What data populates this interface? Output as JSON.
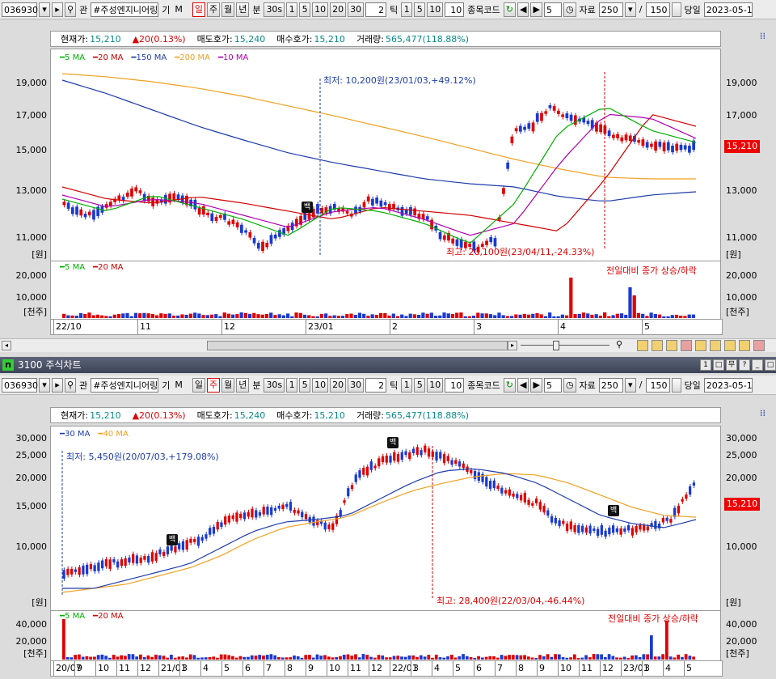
{
  "toolbar": {
    "code": "036930",
    "name": "#주성엔지니어링",
    "flags": [
      "관",
      "기",
      "M"
    ],
    "periods": [
      "일",
      "주",
      "월",
      "년"
    ],
    "unit_label": "분",
    "minute_values": [
      "30s",
      "1",
      "5",
      "10",
      "20",
      "30"
    ],
    "tick_value": "2",
    "tick_label": "틱",
    "tick_values": [
      "1",
      "5",
      "10"
    ],
    "tick_input": "10",
    "code_label": "종목코드",
    "step_value": "5",
    "data_label": "자료",
    "data_count": "250",
    "page_sep": "/",
    "page_value": "150",
    "today_label": "당일",
    "date": "2023-05-1"
  },
  "info": {
    "cur_label": "현재가:",
    "cur_value": "15,210",
    "change_value": "▲20(0.13%)",
    "ask_label": "매도호가:",
    "ask_value": "15,240",
    "bid_label": "매수호가:",
    "bid_value": "15,210",
    "volume_label": "거래량:",
    "volume_value": "565,477(118.88%)"
  },
  "chart1": {
    "ma_legend": [
      {
        "name": "5 MA",
        "color": "#00b000"
      },
      {
        "name": "20 MA",
        "color": "#d00000"
      },
      {
        "name": "150 MA",
        "color": "#1e3caa"
      },
      {
        "name": "200 MA",
        "color": "#f0a020"
      },
      {
        "name": "10 MA",
        "color": "#b000b0"
      }
    ],
    "y_ticks": [
      "19,000",
      "17,000",
      "15,000",
      "13,000",
      "11,000"
    ],
    "unit": "[원]",
    "low_annot": "최저: 10,200원(23/01/03,+49.12%)",
    "high_annot": "최고: 20,100원(23/04/11,-24.33%)",
    "vol_legend": [
      {
        "name": "5 MA",
        "color": "#00b000"
      },
      {
        "name": "20 MA",
        "color": "#d00000"
      }
    ],
    "vol_ticks": [
      "20,000",
      "10,000"
    ],
    "vol_unit": "[천주]",
    "vol_annot": "전일대비 종가 상승/하락",
    "x_labels": [
      "22/10",
      "11",
      "12",
      "23/01",
      "2",
      "3",
      "4",
      "5"
    ],
    "price_tag": "15,210"
  },
  "window2": {
    "title": "3100 주식차트",
    "logo": "n",
    "buttons": [
      "1",
      "□",
      "무",
      "?",
      "_",
      "□",
      "×"
    ]
  },
  "chart2": {
    "ma_legend": [
      {
        "name": "30 MA",
        "color": "#1e3caa"
      },
      {
        "name": "40 MA",
        "color": "#f0a020"
      }
    ],
    "y_ticks": [
      "30,000",
      "25,000",
      "20,000",
      "15,000",
      "10,000"
    ],
    "unit": "[원]",
    "low_annot": "최저: 5,450원(20/07/03,+179.08%)",
    "high_annot": "최고: 28,400원(22/03/04,-46.44%)",
    "vol_legend": [
      {
        "name": "5 MA",
        "color": "#00b000"
      },
      {
        "name": "20 MA",
        "color": "#d00000"
      }
    ],
    "vol_ticks": [
      "40,000",
      "20,000"
    ],
    "vol_unit": "[천주]",
    "vol_annot": "전일대비 종가 상승/하락",
    "x_labels": [
      "20/07",
      "9",
      "10",
      "11",
      "12",
      "21/01",
      "3",
      "4",
      "5",
      "6",
      "7",
      "8",
      "9",
      "10",
      "11",
      "12",
      "22/01",
      "3",
      "4",
      "5",
      "6",
      "7",
      "8",
      "9",
      "10",
      "11",
      "12",
      "23/01",
      "3",
      "4",
      "5"
    ],
    "price_tag": "15,210"
  },
  "stamp_label": "백"
}
